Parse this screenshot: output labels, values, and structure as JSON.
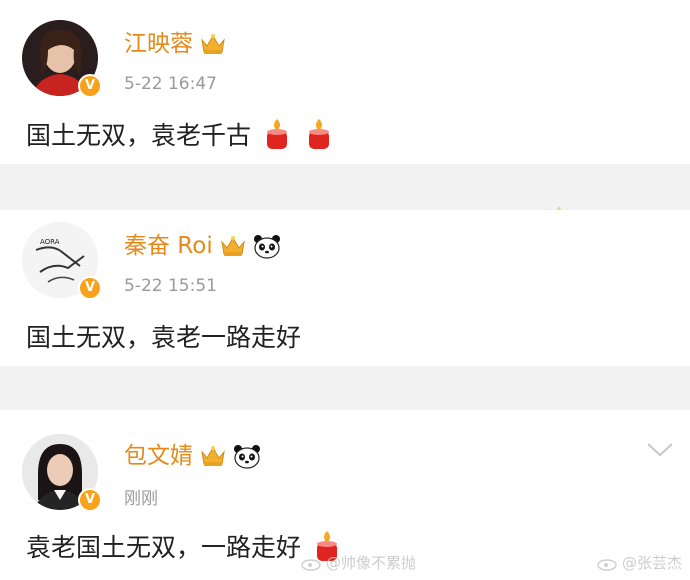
{
  "posts": [
    {
      "name": "江映蓉",
      "time": "5-22 16:47",
      "content": "国土无双，袁老千古",
      "badge": "V",
      "emoji": [
        "crown-icon"
      ],
      "content_emoji": [
        "candle-icon",
        "candle-icon"
      ]
    },
    {
      "name": "秦奋 Roi",
      "time": "5-22 15:51",
      "content": "国土无双，袁老一路走好",
      "badge": "V",
      "emoji": [
        "crown-icon",
        "panda-icon"
      ]
    },
    {
      "name": "包文婧",
      "time": "刚刚",
      "content": "袁老国土无双，一路走好",
      "badge": "V",
      "emoji": [
        "crown-icon",
        "panda-icon"
      ],
      "content_emoji": [
        "candle-icon"
      ]
    }
  ],
  "watermarks": [
    "@帅像不累抛",
    "@张芸杰"
  ],
  "colors": {
    "name": "#e58a1a",
    "time": "#9a9a9a",
    "separator": "#f2f2f2",
    "badge": "#f7a21a"
  }
}
